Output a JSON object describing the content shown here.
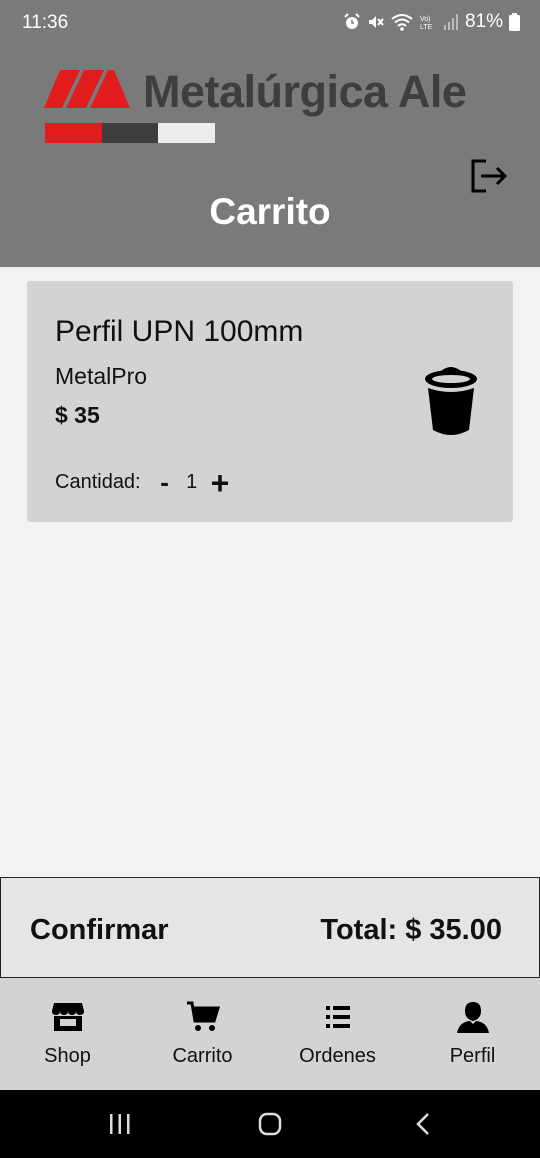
{
  "status_bar": {
    "time": "11:36",
    "battery": "81%",
    "icons": [
      "alarm-icon",
      "mute-icon",
      "wifi-icon",
      "volte-icon",
      "signal-icon",
      "battery-icon"
    ]
  },
  "header": {
    "brand": "Metalúrgica Ale",
    "brand_colors": {
      "red": "#e01c1c",
      "dark": "#3e3e3e",
      "white": "#ececec"
    },
    "title": "Carrito",
    "logout_icon": "logout-icon"
  },
  "cart": {
    "items": [
      {
        "name": "Perfil UPN 100mm",
        "brand": "MetalPro",
        "price": "$ 35",
        "quantity_label": "Cantidad:",
        "minus": "-",
        "quantity": "1",
        "plus": "+",
        "delete_icon": "trash-icon"
      }
    ]
  },
  "footer": {
    "confirm_label": "Confirmar",
    "total_text": "Total: $ 35.00"
  },
  "bottom_nav": [
    {
      "label": "Shop",
      "icon": "store-icon"
    },
    {
      "label": "Carrito",
      "icon": "cart-icon"
    },
    {
      "label": "Ordenes",
      "icon": "list-icon"
    },
    {
      "label": "Perfil",
      "icon": "user-icon"
    }
  ],
  "system_nav": [
    "recents-icon",
    "home-icon",
    "back-icon"
  ],
  "colors": {
    "header_bg": "#7a7a7a",
    "page_bg": "#f2f2f2",
    "card_bg": "#d3d3d3",
    "confirm_bg": "#e4e6e4",
    "nav_bg": "#d3d3d3"
  }
}
